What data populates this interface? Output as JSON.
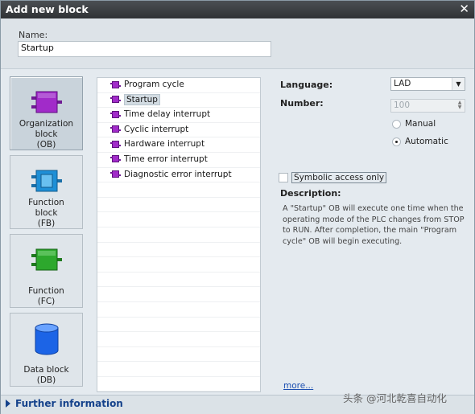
{
  "window": {
    "title": "Add new block"
  },
  "name_field": {
    "label": "Name:",
    "value": "Startup"
  },
  "block_types": [
    {
      "label": "Organization block (OB)",
      "line1": "Organization",
      "line2": "block",
      "line3": "(OB)",
      "icon": "ob-icon",
      "color": "#a12bc9"
    },
    {
      "label": "Function block (FB)",
      "line1": "Function",
      "line2": "block",
      "line3": "(FB)",
      "icon": "fb-icon",
      "color": "#1e8fd6"
    },
    {
      "label": "Function (FC)",
      "line1": "Function",
      "line2": "(FC)",
      "icon": "fc-icon",
      "color": "#2da82d"
    },
    {
      "label": "Data block (DB)",
      "line1": "Data block",
      "line2": "(DB)",
      "icon": "db-icon",
      "color": "#1c64e6"
    }
  ],
  "ob_list": [
    "Program cycle",
    "Startup",
    "Time delay interrupt",
    "Cyclic interrupt",
    "Hardware interrupt",
    "Time error interrupt",
    "Diagnostic error interrupt"
  ],
  "selected_ob": "Startup",
  "properties": {
    "language_label": "Language:",
    "language_value": "LAD",
    "number_label": "Number:",
    "number_value": "100",
    "radio_manual": "Manual",
    "radio_automatic": "Automatic",
    "radio_selected": "Automatic",
    "symbolic_label": "Symbolic access only",
    "description_label": "Description:",
    "description_text": "A \"Startup\" OB will execute one time when the operating mode of the PLC changes from STOP to RUN. After completion, the main \"Program cycle\" OB will begin executing.",
    "more_link": "more..."
  },
  "footer": {
    "further_label": "Further information",
    "watermark": "头条 @河北乾喜自动化"
  }
}
